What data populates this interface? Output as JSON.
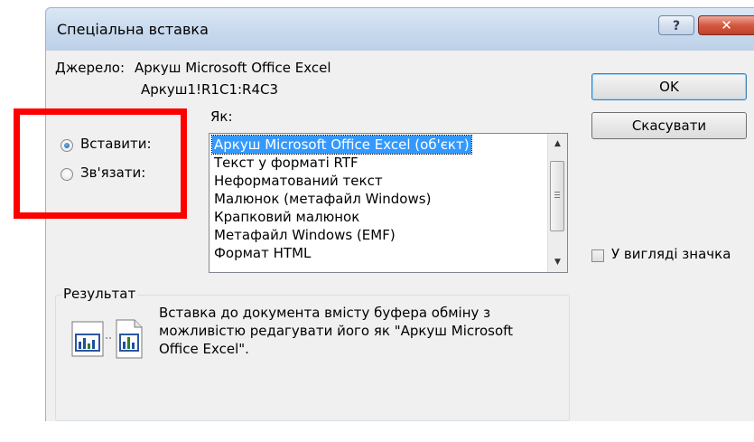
{
  "window": {
    "title": "Спеціальна вставка",
    "help_label": "?",
    "close_label": "✕"
  },
  "source": {
    "label": "Джерело:",
    "app": "Аркуш Microsoft Office Excel",
    "range": "Аркуш1!R1C1:R4C3"
  },
  "as_label": "Як:",
  "paste_mode": {
    "options": [
      {
        "label": "Вставити:",
        "selected": true
      },
      {
        "label": "Зв'язати:",
        "selected": false
      }
    ]
  },
  "formats": [
    "Аркуш Microsoft Office Excel (об'єкт)",
    "Текст у форматі RTF",
    "Неформатований текст",
    "Малюнок (метафайл Windows)",
    "Крапковий малюнок",
    "Метафайл Windows (EMF)",
    "Формат HTML"
  ],
  "selected_format_index": 0,
  "buttons": {
    "ok": "OK",
    "cancel": "Скасувати"
  },
  "display_as_icon": {
    "label": "У вигляді значка",
    "checked": false
  },
  "result": {
    "title": "Результат",
    "lines": [
      "Вставка до документа вмісту буфера обміну з",
      "можливістю редагувати його як \"Аркуш Microsoft",
      "Office Excel\"."
    ]
  },
  "colors": {
    "selection": "#3399ff",
    "highlight": "#ff0000",
    "titlebar": "#c9daee"
  },
  "icons": {
    "scroll_up": "chevron-up-icon",
    "scroll_down": "chevron-down-icon",
    "result": "excel-chart-icon"
  }
}
